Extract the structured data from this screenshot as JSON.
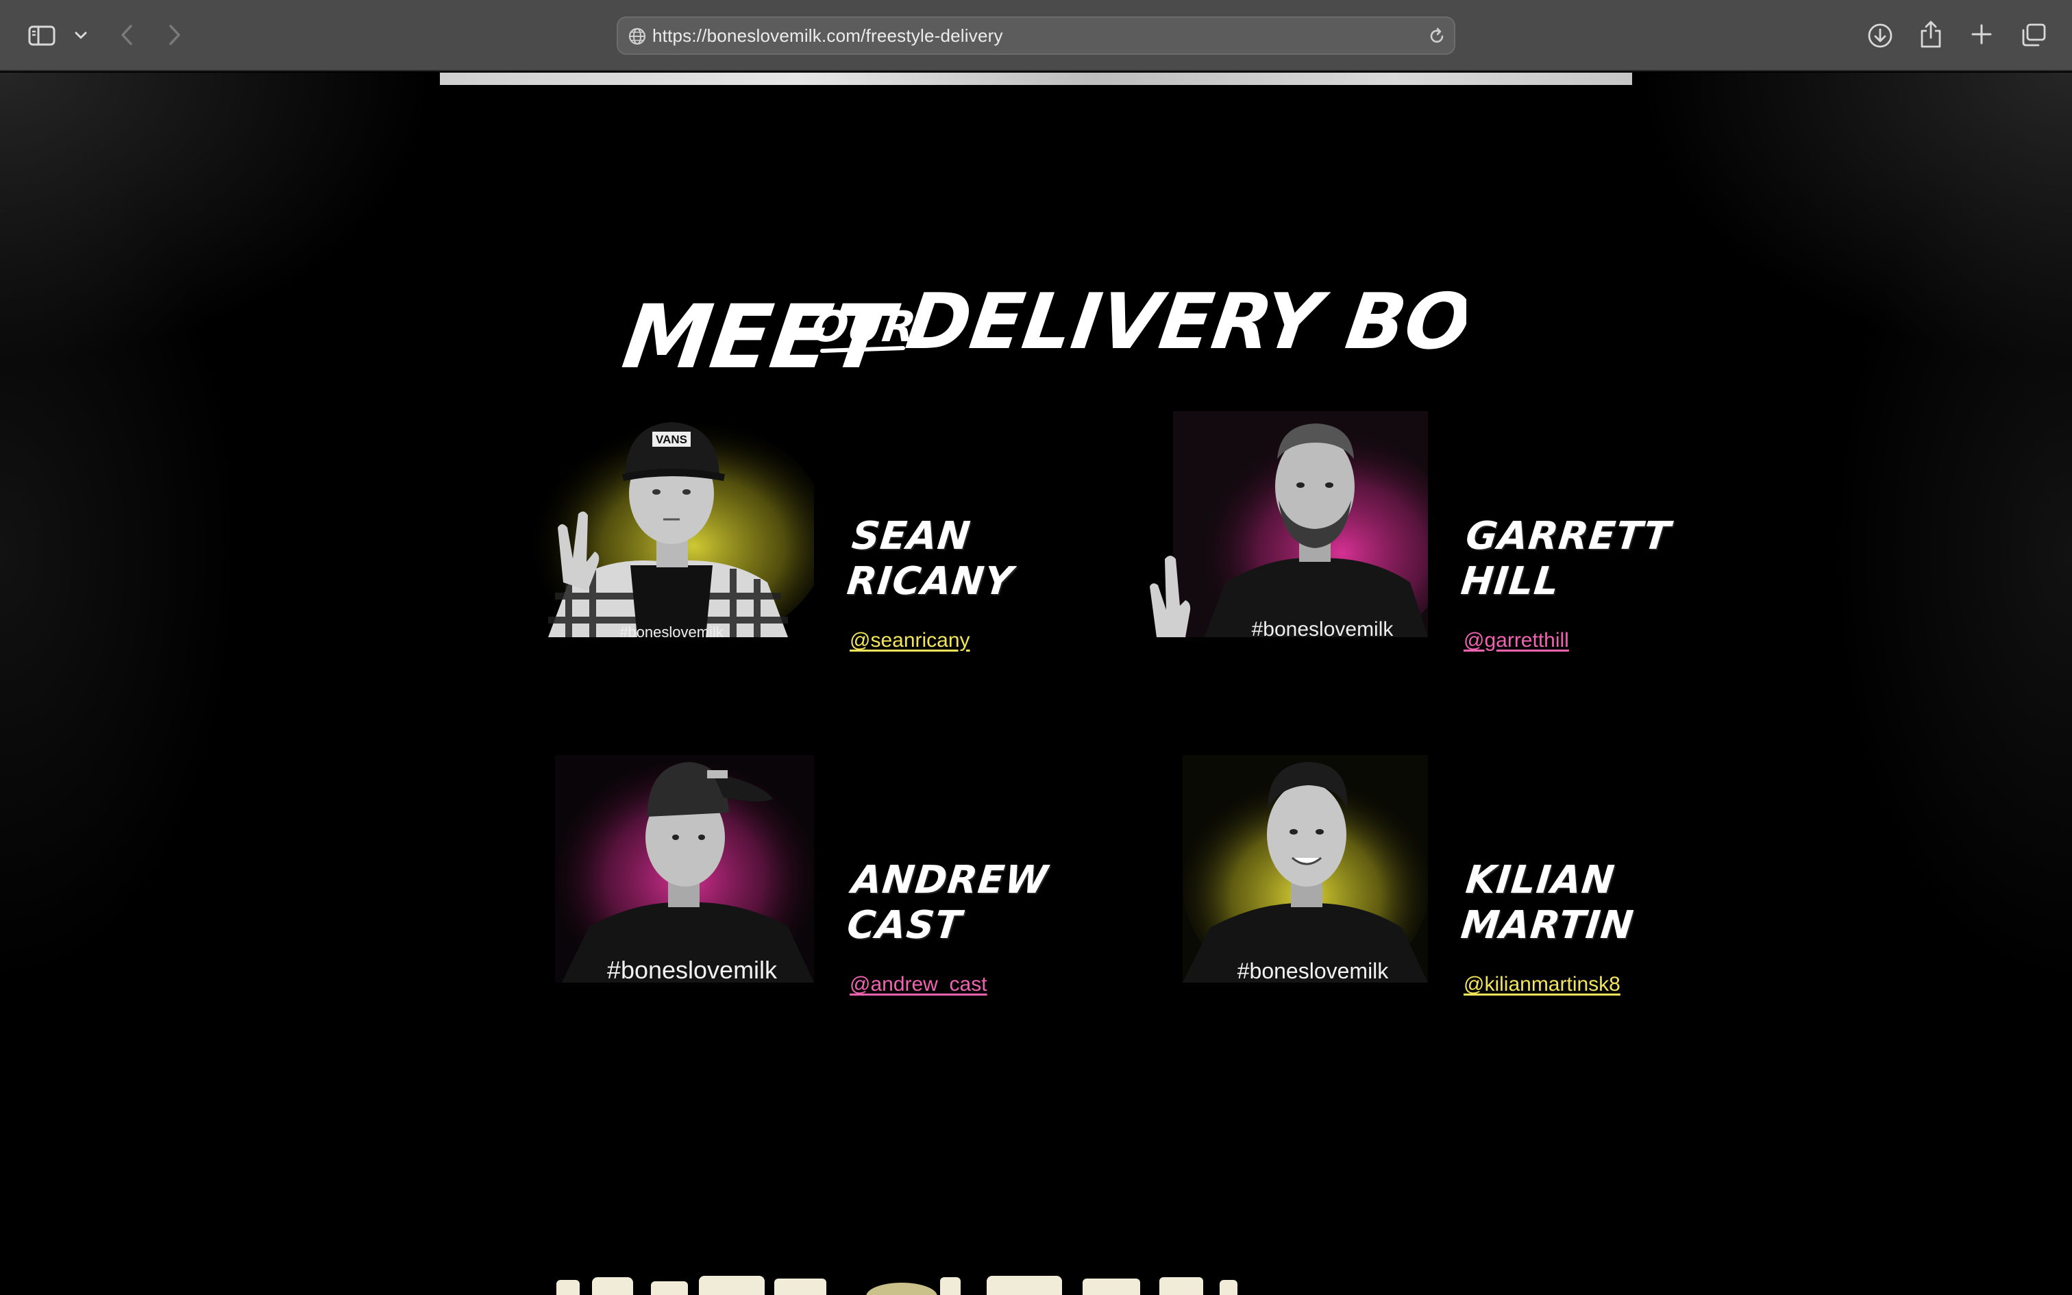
{
  "browser": {
    "url": "https://boneslovemilk.com/freestyle-delivery"
  },
  "page": {
    "heading": {
      "word1": "MEET",
      "word2": "OUR",
      "word3": "DELIVERY BOYS"
    },
    "riders": [
      {
        "first": "SEAN",
        "last": "RICANY",
        "handle": "@seanricany",
        "splash": "yellow"
      },
      {
        "first": "GARRETT",
        "last": "HILL",
        "handle": "@garretthill",
        "splash": "pink"
      },
      {
        "first": "ANDREW",
        "last": "CAST",
        "handle": "@andrew_cast",
        "splash": "pink"
      },
      {
        "first": "KILIAN",
        "last": "MARTIN",
        "handle": "@kilianmartinsk8",
        "splash": "yellow"
      }
    ],
    "shirt_text": "#boneslovemilk",
    "cap_text": "VANS"
  },
  "colors": {
    "yellow": "#e6df3a",
    "pink": "#e0339a",
    "link_yellow": "#f2e45b",
    "link_pink": "#ef63b0"
  }
}
